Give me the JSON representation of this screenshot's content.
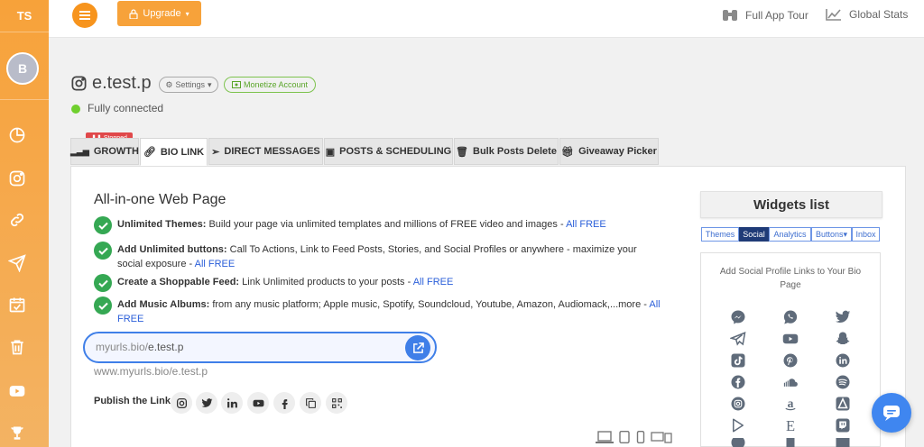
{
  "sidebar": {
    "initials": "TS",
    "avatar_letter": "B",
    "items": [
      {
        "icon": "pie-chart-icon"
      },
      {
        "icon": "instagram-icon"
      },
      {
        "icon": "link-icon"
      },
      {
        "icon": "paper-plane-icon"
      },
      {
        "icon": "calendar-check-icon"
      },
      {
        "icon": "trash-icon"
      },
      {
        "icon": "youtube-icon"
      },
      {
        "icon": "trophy-icon"
      }
    ]
  },
  "topbar": {
    "upgrade_label": "Upgrade",
    "full_app_tour": "Full App Tour",
    "global_stats": "Global Stats"
  },
  "account": {
    "name": "e.test.p",
    "settings_label": "Settings",
    "monetize_label": "Monetize Account",
    "status": "Fully connected"
  },
  "tabs": [
    {
      "label": "GROWTH",
      "badge": "Stopped"
    },
    {
      "label": "BIO LINK"
    },
    {
      "label": "DIRECT MESSAGES"
    },
    {
      "label": "POSTS & SCHEDULING"
    },
    {
      "label": "Bulk Posts Delete"
    },
    {
      "label": "Giveaway Picker"
    }
  ],
  "biolink": {
    "title": "All-in-one Web Page",
    "features": [
      {
        "bold": "Unlimited Themes:",
        "text": " Build your page via unlimited templates and millions of FREE video and images - ",
        "free": "All FREE"
      },
      {
        "bold": "Add Unlimited buttons:",
        "text": " Call To Actions, Link to Feed Posts, Stories, and Social Profiles or anywhere - maximize your social exposure - ",
        "free": "All FREE"
      },
      {
        "bold": "Create a Shoppable Feed:",
        "text": " Link Unlimited products to your posts - ",
        "free": "All FREE"
      },
      {
        "bold": "Add Music Albums:",
        "text": " from any music platform; Apple music, Spotify, Soundcloud, Youtube, Amazon, Audiomack,...more - ",
        "free": "All FREE"
      }
    ],
    "url_prefix": "myurls.bio/",
    "url_value": "e.test.p",
    "url_full": "www.myurls.bio/e.test.p",
    "publish_label": "Publish the Link:"
  },
  "widgets": {
    "title": "Widgets list",
    "tabs": [
      "Themes",
      "Social",
      "Analytics",
      "Buttons",
      "Inbox"
    ],
    "active_tab": "Social",
    "description": "Add Social Profile Links to Your Bio Page"
  }
}
